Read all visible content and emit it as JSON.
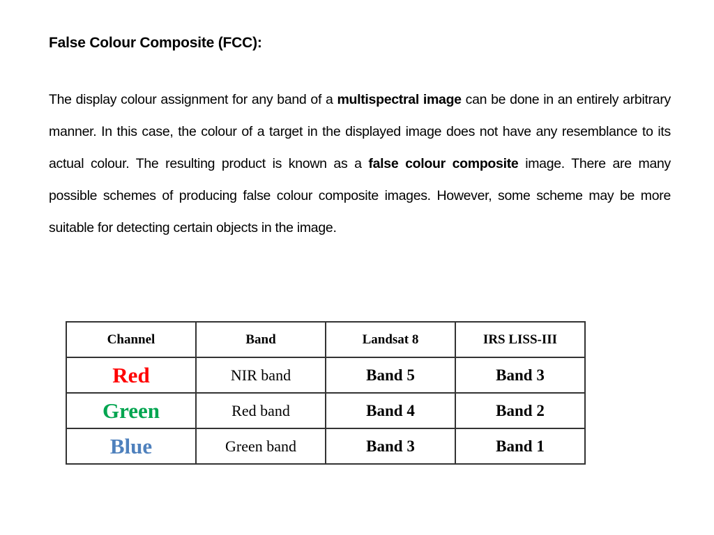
{
  "title": "False Colour Composite (FCC):",
  "paragraph": {
    "part1": "The display colour assignment for any band of a ",
    "bold1": "multispectral image",
    "part2": " can be done in an entirely arbitrary manner. In this case, the colour of a target in the displayed image does not have any resemblance to its actual colour. The resulting product is known as a ",
    "bold2": "false colour composite",
    "part3": " image. There are many possible schemes of producing false colour composite images. However, some scheme may be more suitable for detecting certain objects in the image."
  },
  "table": {
    "headers": [
      "Channel",
      "Band",
      "Landsat 8",
      "IRS LISS-III"
    ],
    "rows": [
      {
        "channel": "Red",
        "channel_color": "#ff0000",
        "band": "NIR band",
        "landsat8": "Band 5",
        "irs": "Band 3"
      },
      {
        "channel": "Green",
        "channel_color": "#00a550",
        "band": "Red band",
        "landsat8": "Band 4",
        "irs": "Band 2"
      },
      {
        "channel": "Blue",
        "channel_color": "#4f81bd",
        "band": "Green band",
        "landsat8": "Band 3",
        "irs": "Band 1"
      }
    ]
  }
}
